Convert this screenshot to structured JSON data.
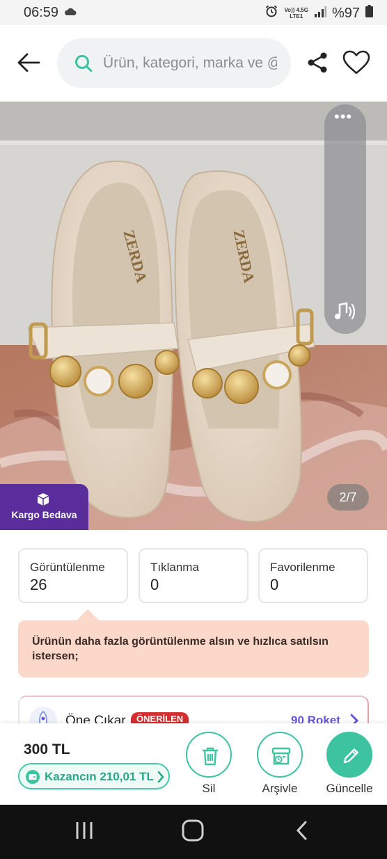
{
  "status_bar": {
    "time": "06:59",
    "network_top": "Vo)) 4.5G",
    "network_bottom": "LTE1",
    "battery": "%97"
  },
  "header": {
    "search_placeholder": "Ürün, kategori, marka ve @"
  },
  "photo": {
    "cargo_badge": "Kargo Bedava",
    "page_indicator": "2/7",
    "brand_print": "ZERDA"
  },
  "stats": [
    {
      "label": "Görüntülenme",
      "value": "26"
    },
    {
      "label": "Tıklanma",
      "value": "0"
    },
    {
      "label": "Favorilenme",
      "value": "0"
    }
  ],
  "tip": {
    "text": "Ürünün daha fazla görüntülenme alsın ve hızlıca satılsın istersen;"
  },
  "promo": {
    "title": "Öne Çıkar",
    "badge": "ÖNERİLEN",
    "price": "90 Roket"
  },
  "bottom_bar": {
    "price": "300 TL",
    "earning": "Kazancın 210,01 TL",
    "actions": [
      {
        "label": "Sil",
        "icon": "trash-icon"
      },
      {
        "label": "Arşivle",
        "icon": "archive-icon"
      },
      {
        "label": "Güncelle",
        "icon": "pencil-icon"
      }
    ]
  },
  "colors": {
    "accent": "#3ec3a1",
    "cargo_badge": "#5a2d9c",
    "tip_background": "#fbd8c9",
    "badge_red": "#d32f2f",
    "roket_purple": "#6b55d8"
  }
}
